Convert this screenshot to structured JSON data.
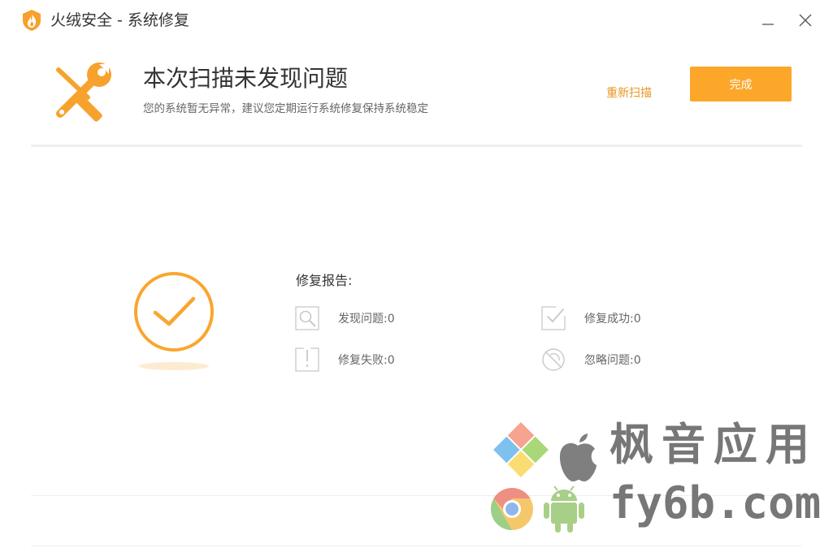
{
  "window": {
    "title": "火绒安全 - 系统修复"
  },
  "header": {
    "title": "本次扫描未发现问题",
    "subtitle": "您的系统暂无异常，建议您定期运行系统修复保持系统稳定",
    "rescan_label": "重新扫描",
    "done_label": "完成"
  },
  "report": {
    "title": "修复报告:",
    "stats": [
      {
        "label": "发现问题:0",
        "icon": "magnifier-icon"
      },
      {
        "label": "修复成功:0",
        "icon": "checkbox-check-icon"
      },
      {
        "label": "修复失败:0",
        "icon": "exclamation-box-icon"
      },
      {
        "label": "忽略问题:0",
        "icon": "ignore-circle-icon"
      }
    ]
  },
  "watermark": {
    "line1": "枫音应用",
    "line2": "fy6b.com"
  },
  "colors": {
    "accent": "#fca62a",
    "accent_text": "#e8961f",
    "icon_gray": "#c8c8c8"
  }
}
